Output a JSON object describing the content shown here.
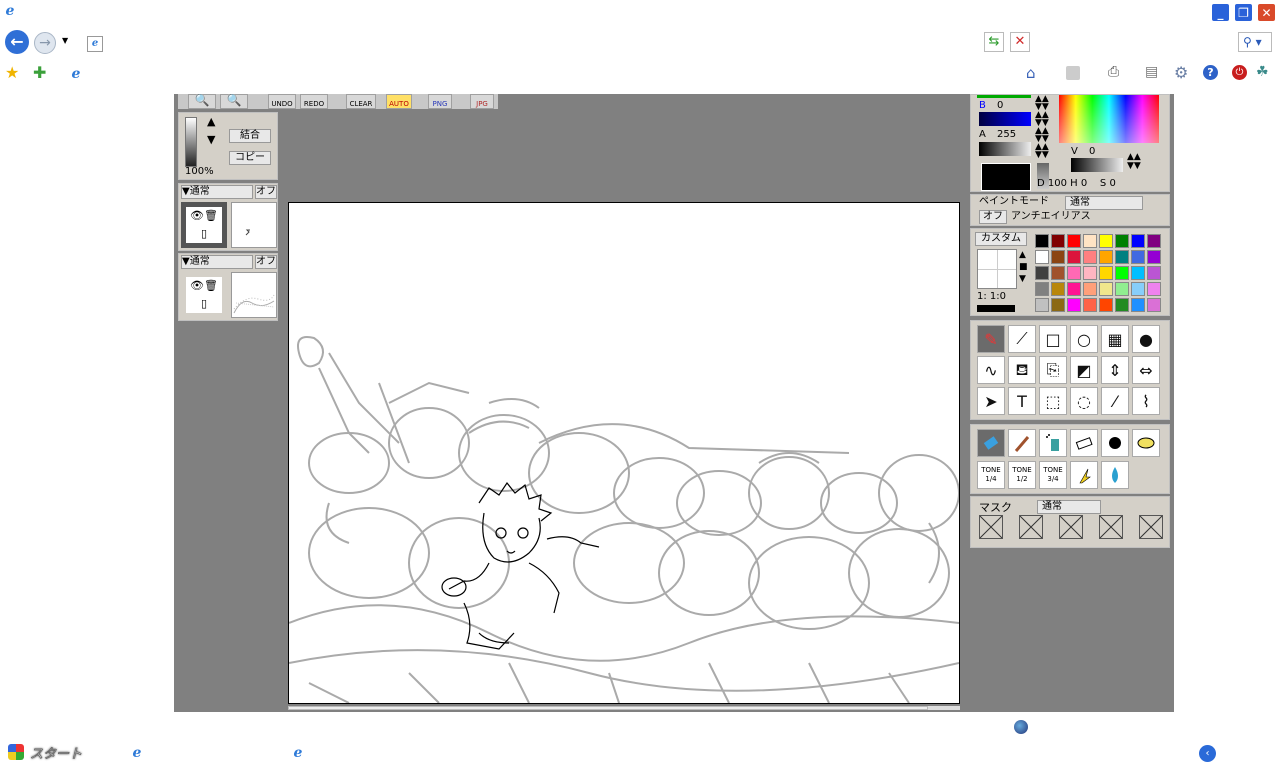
{
  "browser": {
    "favorite_icons": [
      "star-icon",
      "add-favorite-icon"
    ],
    "right_toolbar_icons": [
      "home-icon",
      "feeds-icon",
      "print-icon",
      "page-icon",
      "tools-icon",
      "help-icon",
      "power-icon",
      "research-icon"
    ]
  },
  "app": {
    "toolbar": {
      "undo": "UNDO",
      "redo": "REDO",
      "clear": "CLEAR",
      "auto": "AUTO",
      "png": "PNG",
      "jpg": "JPG"
    },
    "layers": {
      "zoom": "100%",
      "merge": "結合",
      "copy": "コピー",
      "layer1": {
        "mode": "▼通常",
        "toggle": "オフ"
      },
      "layer2": {
        "mode": "▼通常",
        "toggle": "オフ"
      }
    },
    "color": {
      "b_label": "B",
      "b_value": "0",
      "a_label": "A",
      "a_value": "255",
      "v_label": "V",
      "v_value": "0",
      "dhs": "D 100 H 0    S 0"
    },
    "paint_mode": {
      "label": "ペイントモード",
      "value": "通常",
      "toggle": "オフ",
      "antialias": "アンチエイリアス"
    },
    "custom": {
      "label": "カスタム",
      "ratio": "1:  1:0"
    },
    "palette": [
      "#000000",
      "#800000",
      "#ff0000",
      "#ffe4c4",
      "#ffff00",
      "#008000",
      "#0000ff",
      "#800080",
      "#ffffff",
      "#8b4513",
      "#dc143c",
      "#ff8080",
      "#ffa500",
      "#008080",
      "#4169e1",
      "#9400d3",
      "#404040",
      "#a0522d",
      "#ff69b4",
      "#ffb6c1",
      "#ffd700",
      "#00ff00",
      "#00bfff",
      "#ba55d3",
      "#808080",
      "#b8860b",
      "#ff1493",
      "#ffa07a",
      "#f0e68c",
      "#90ee90",
      "#87cefa",
      "#ee82ee",
      "#c0c0c0",
      "#8b6914",
      "#ff00ff",
      "#ff6347",
      "#ff4500",
      "#228b22",
      "#1e90ff",
      "#da70d6"
    ],
    "tools": [
      "pencil-tool-icon",
      "polyline-tool-icon",
      "rectangle-tool-icon",
      "ellipse-tool-icon",
      "filled-rect-tool-icon",
      "filled-ellipse-tool-icon",
      "curve-tool-icon",
      "fill-bucket-tool-icon",
      "copy-tool-icon",
      "layer-fill-tool-icon",
      "flip-vertical-tool-icon",
      "flip-horizontal-tool-icon",
      "move-tool-icon",
      "text-tool-icon",
      "rect-select-tool-icon",
      "lasso-tool-icon",
      "magic-wand-tool-icon",
      "eyedropper-tool-icon"
    ],
    "brushes": {
      "tone1": "TONE\n1/4",
      "tone2": "TONE\n1/2",
      "tone3": "TONE\n3/4"
    },
    "mask": {
      "label": "マスク",
      "value": "通常"
    }
  },
  "taskbar": {
    "start": "スタート"
  }
}
